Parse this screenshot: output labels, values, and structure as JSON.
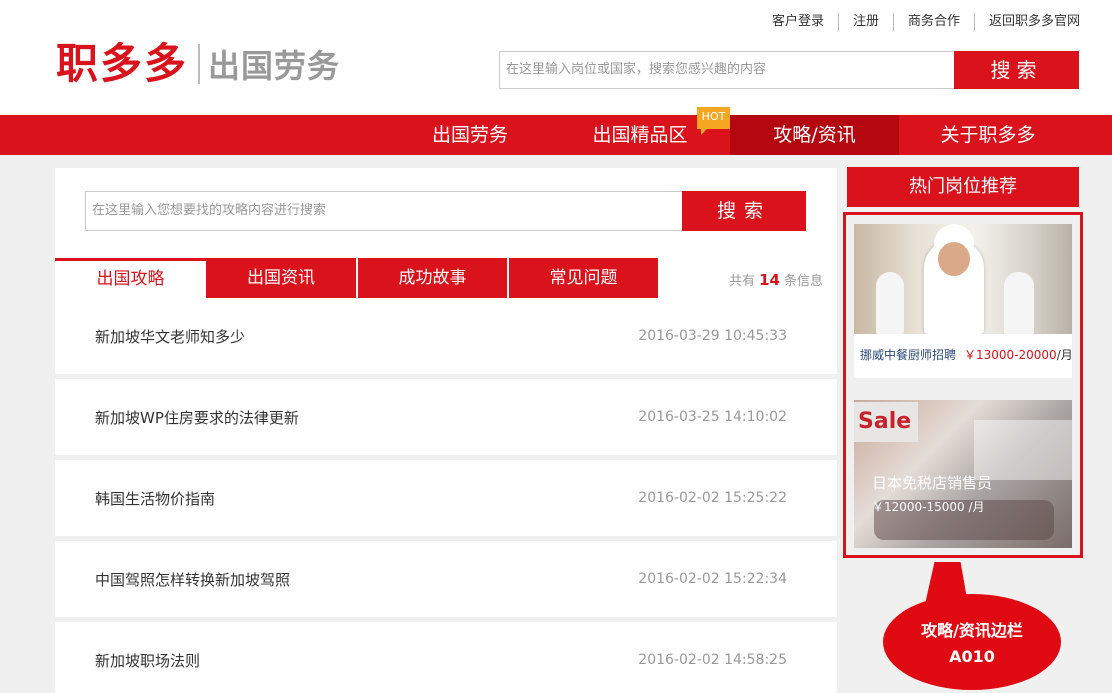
{
  "top_links": [
    "客户登录",
    "注册",
    "商务合作",
    "返回职多多官网"
  ],
  "logo": {
    "main": "职多多",
    "sub": "出国劳务"
  },
  "top_search": {
    "placeholder": "在这里输入岗位或国家，搜索您感兴趣的内容",
    "button": "搜索"
  },
  "nav": {
    "items": [
      "出国劳务",
      "出国精品区",
      "攻略/资讯",
      "关于职多多"
    ],
    "active": "攻略/资讯",
    "hot_badge": "HOT"
  },
  "article_search": {
    "placeholder": "在这里输入您想要找的攻略内容进行搜索",
    "button": "搜索"
  },
  "tabs": {
    "items": [
      "出国攻略",
      "出国资讯",
      "成功故事",
      "常见问题"
    ],
    "active": "出国攻略"
  },
  "count": {
    "prefix": "共有",
    "value": "14",
    "suffix": "条信息"
  },
  "articles": [
    {
      "title": "新加坡华文老师知多少",
      "date": "2016-03-29 10:45:33"
    },
    {
      "title": "新加坡WP住房要求的法律更新",
      "date": "2016-03-25 14:10:02"
    },
    {
      "title": "韩国生活物价指南",
      "date": "2016-02-02 15:25:22"
    },
    {
      "title": "中国驾照怎样转换新加坡驾照",
      "date": "2016-02-02 15:22:34"
    },
    {
      "title": "新加坡职场法则",
      "date": "2016-02-02 14:58:25"
    }
  ],
  "sidebar": {
    "title": "热门岗位推荐",
    "jobs": [
      {
        "name": "挪威中餐厨师招聘",
        "price": "￥13000-20000",
        "unit": "/月"
      },
      {
        "name": "日本免税店销售员",
        "price": "￥12000-15000",
        "unit": "/月",
        "image_text": "Sale"
      }
    ]
  },
  "annotation": {
    "line1": "攻略/资讯边栏",
    "line2": "A010"
  },
  "colors": {
    "brand_red": "#d9121b",
    "active_nav": "#b5070f",
    "hot_orange": "#f5a623"
  }
}
